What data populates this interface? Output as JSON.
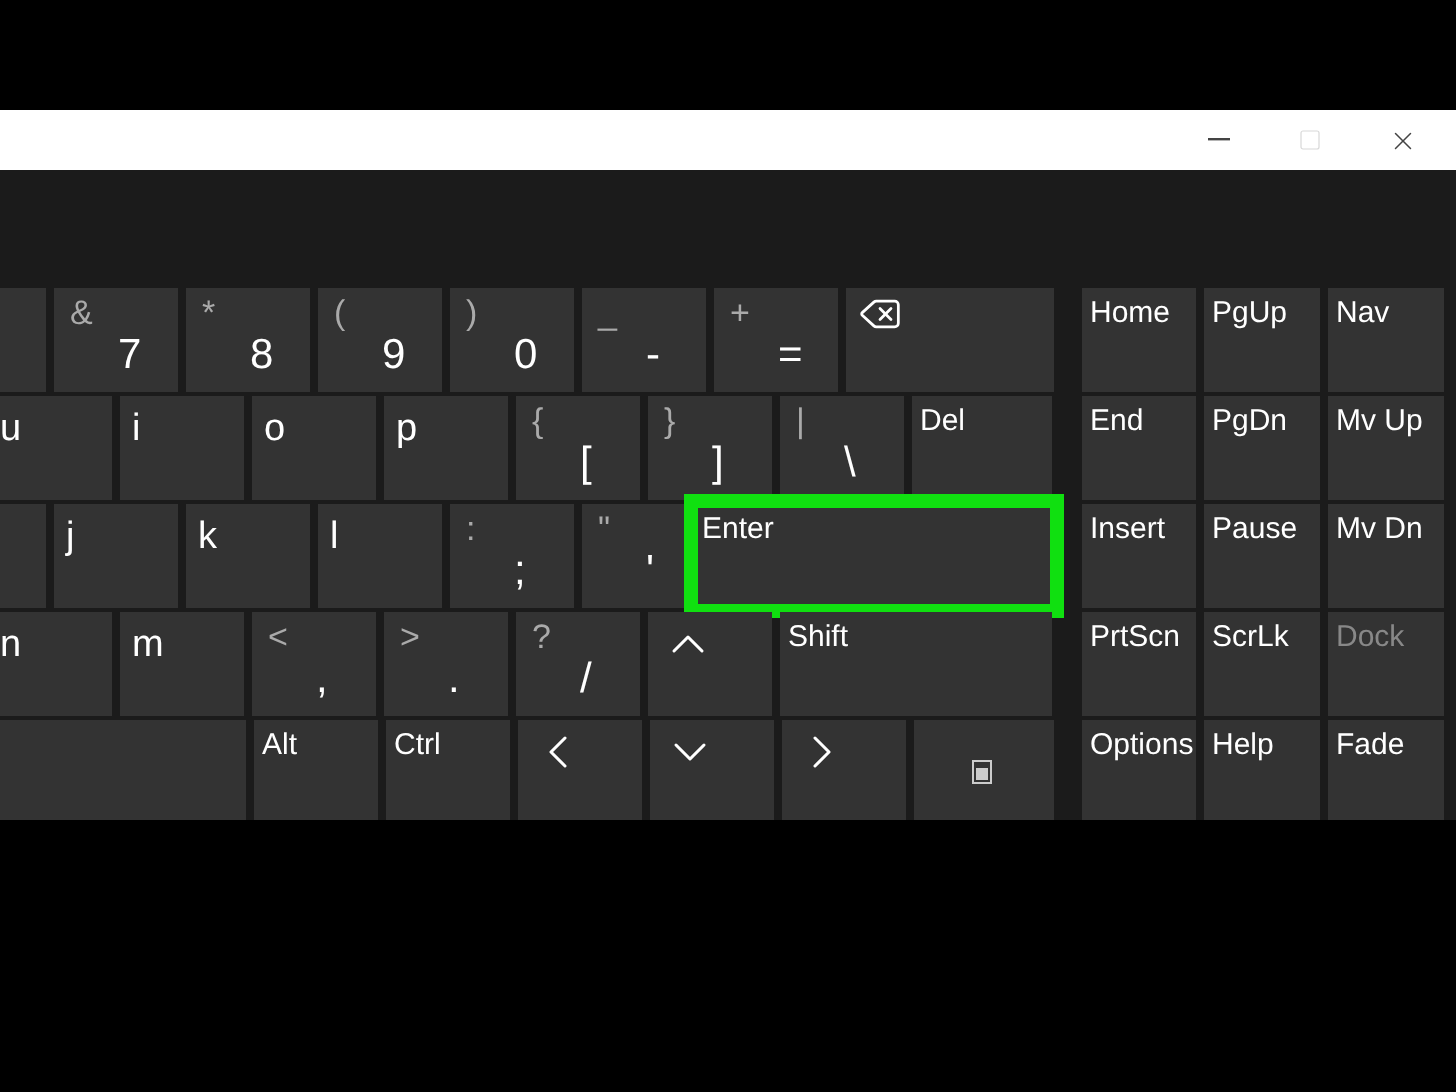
{
  "window": {
    "controls": [
      {
        "kind": "minimize",
        "disabled": false
      },
      {
        "kind": "maximize",
        "disabled": true
      },
      {
        "kind": "close",
        "disabled": false
      }
    ]
  },
  "main_rows": [
    [
      {
        "kind": "blank"
      },
      {
        "kind": "char",
        "shift": "&",
        "char": "7"
      },
      {
        "kind": "char",
        "shift": "*",
        "char": "8"
      },
      {
        "kind": "char",
        "shift": "(",
        "char": "9"
      },
      {
        "kind": "char",
        "shift": ")",
        "char": "0"
      },
      {
        "kind": "char",
        "shift": "_",
        "char": "-"
      },
      {
        "kind": "char",
        "shift": "+",
        "char": "="
      },
      {
        "kind": "backspace"
      }
    ],
    [
      {
        "kind": "label",
        "label": "u"
      },
      {
        "kind": "label",
        "label": "i"
      },
      {
        "kind": "label",
        "label": "o"
      },
      {
        "kind": "label",
        "label": "p"
      },
      {
        "kind": "char",
        "shift": "{",
        "char": "["
      },
      {
        "kind": "char",
        "shift": "}",
        "char": "]"
      },
      {
        "kind": "char",
        "shift": "|",
        "char": "\\"
      },
      {
        "kind": "label",
        "label": "Del"
      }
    ],
    [
      {
        "kind": "blank"
      },
      {
        "kind": "label",
        "label": "j"
      },
      {
        "kind": "label",
        "label": "k"
      },
      {
        "kind": "label",
        "label": "l"
      },
      {
        "kind": "char",
        "shift": ":",
        "char": ";"
      },
      {
        "kind": "char",
        "shift": "\"",
        "char": "'"
      },
      {
        "kind": "label",
        "label": "Enter",
        "highlighted": true
      }
    ],
    [
      {
        "kind": "label",
        "label": "n"
      },
      {
        "kind": "label",
        "label": "m"
      },
      {
        "kind": "char",
        "shift": "<",
        "char": ","
      },
      {
        "kind": "char",
        "shift": ">",
        "char": "."
      },
      {
        "kind": "char",
        "shift": "?",
        "char": "/"
      },
      {
        "kind": "up"
      },
      {
        "kind": "label",
        "label": "Shift"
      }
    ],
    [
      {
        "kind": "blank"
      },
      {
        "kind": "label",
        "label": "Alt"
      },
      {
        "kind": "label",
        "label": "Ctrl"
      },
      {
        "kind": "left"
      },
      {
        "kind": "down"
      },
      {
        "kind": "right"
      },
      {
        "kind": "menu"
      }
    ]
  ],
  "side_rows": [
    [
      {
        "label": "Home",
        "disabled": false
      },
      {
        "label": "PgUp",
        "disabled": false
      },
      {
        "label": "Nav",
        "disabled": false
      }
    ],
    [
      {
        "label": "End",
        "disabled": false
      },
      {
        "label": "PgDn",
        "disabled": false
      },
      {
        "label": "Mv Up",
        "disabled": false
      }
    ],
    [
      {
        "label": "Insert",
        "disabled": false
      },
      {
        "label": "Pause",
        "disabled": false
      },
      {
        "label": "Mv Dn",
        "disabled": false
      }
    ],
    [
      {
        "label": "PrtScn",
        "disabled": false
      },
      {
        "label": "ScrLk",
        "disabled": false
      },
      {
        "label": "Dock",
        "disabled": true
      }
    ],
    [
      {
        "label": "Options",
        "disabled": false
      },
      {
        "label": "Help",
        "disabled": false
      },
      {
        "label": "Fade",
        "disabled": false
      }
    ]
  ]
}
